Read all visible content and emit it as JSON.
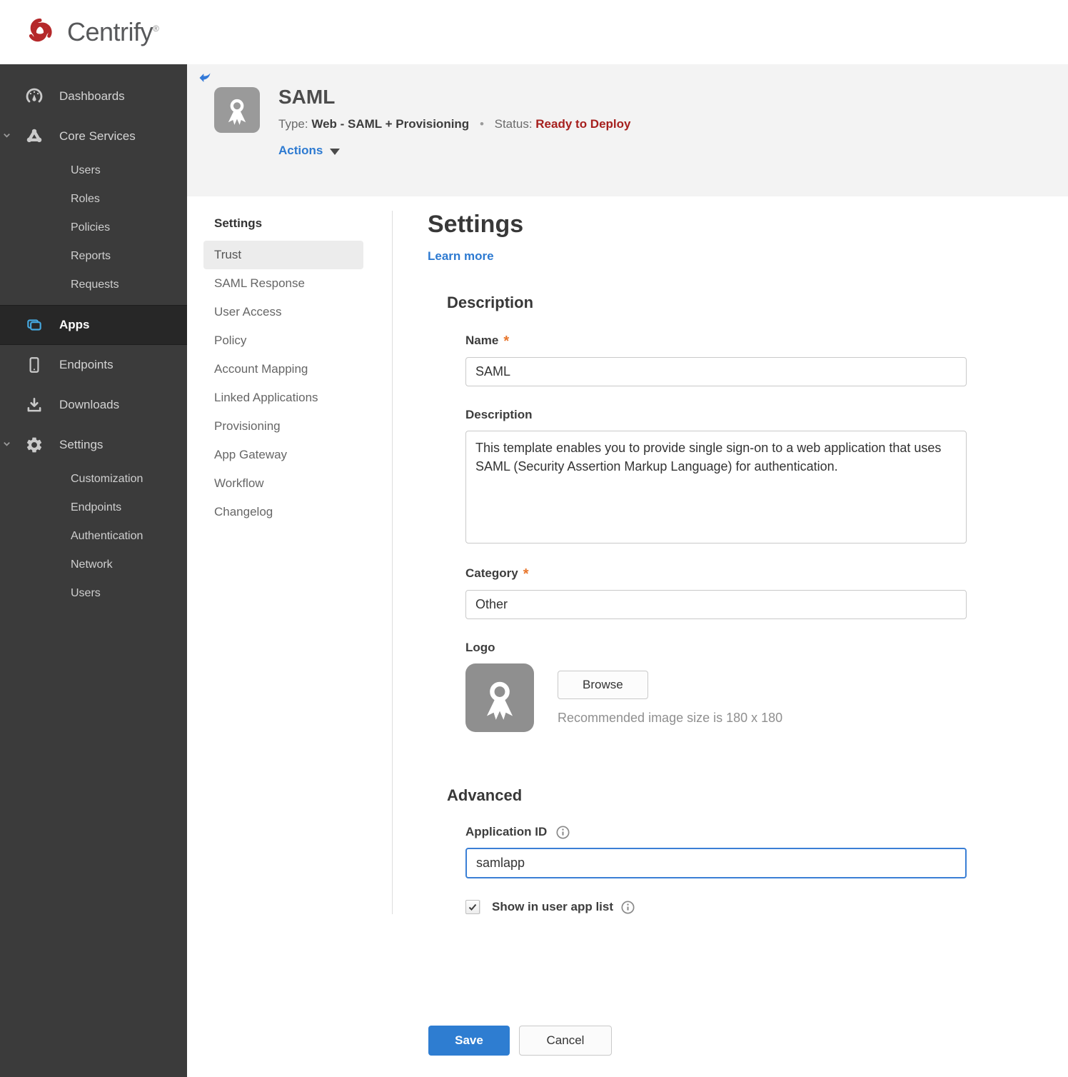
{
  "brand": {
    "name": "Centrify",
    "registered": "®"
  },
  "sidebar": {
    "dashboards": "Dashboards",
    "core_services": "Core Services",
    "core_children": [
      "Users",
      "Roles",
      "Policies",
      "Reports",
      "Requests"
    ],
    "apps": "Apps",
    "endpoints": "Endpoints",
    "downloads": "Downloads",
    "settings": "Settings",
    "settings_children": [
      "Customization",
      "Endpoints",
      "Authentication",
      "Network",
      "Users"
    ]
  },
  "header": {
    "title": "SAML",
    "type_label": "Type:",
    "type_value": "Web - SAML + Provisioning",
    "separator": "•",
    "status_label": "Status:",
    "status_value": "Ready to Deploy",
    "actions": "Actions"
  },
  "subnav": {
    "title": "Settings",
    "active_item": "Trust",
    "items": [
      "Trust",
      "SAML Response",
      "User Access",
      "Policy",
      "Account Mapping",
      "Linked Applications",
      "Provisioning",
      "App Gateway",
      "Workflow",
      "Changelog"
    ]
  },
  "main": {
    "title": "Settings",
    "learn_more": "Learn more",
    "required_marker": "*",
    "description": {
      "heading": "Description",
      "name_label": "Name",
      "name_value": "SAML",
      "desc_label": "Description",
      "desc_value": "This template enables you to provide single sign-on to a web application that uses SAML (Security Assertion Markup Language) for authentication.",
      "category_label": "Category",
      "category_value": "Other",
      "logo_label": "Logo",
      "browse_button": "Browse",
      "logo_hint": "Recommended image size is 180 x 180"
    },
    "advanced": {
      "heading": "Advanced",
      "app_id_label": "Application ID",
      "app_id_value": "samlapp",
      "show_label": "Show in user app list",
      "show_checked": true
    },
    "save_button": "Save",
    "cancel_button": "Cancel"
  },
  "colors": {
    "accent_blue": "#2e7dd1",
    "link_blue": "#2d7ad1",
    "apps_icon_blue": "#45a8e0",
    "status_red": "#a6201e",
    "brand_red": "#b5282a",
    "sidebar_bg": "#3b3b3b",
    "sidebar_active_bg": "#272727",
    "required_orange": "#e8762c",
    "header_band_bg": "#f3f3f3"
  }
}
